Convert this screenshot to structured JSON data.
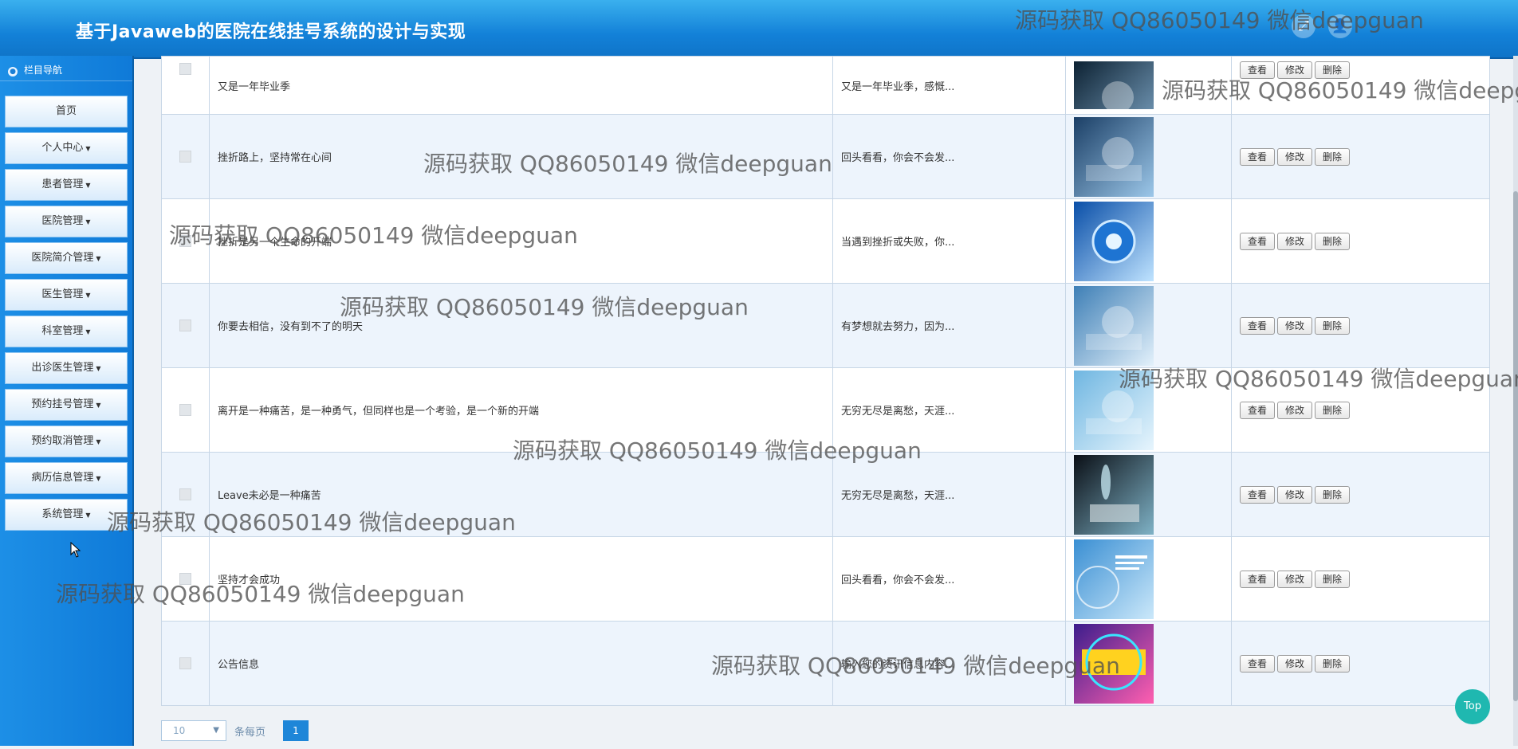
{
  "header": {
    "title": "基于Javaweb的医院在线挂号系统的设计与实现"
  },
  "sidebar": {
    "heading": "栏目导航",
    "items": [
      {
        "label": "首页",
        "dropdown": false
      },
      {
        "label": "个人中心",
        "dropdown": true
      },
      {
        "label": "患者管理",
        "dropdown": true
      },
      {
        "label": "医院管理",
        "dropdown": true
      },
      {
        "label": "医院简介管理",
        "dropdown": true
      },
      {
        "label": "医生管理",
        "dropdown": true
      },
      {
        "label": "科室管理",
        "dropdown": true
      },
      {
        "label": "出诊医生管理",
        "dropdown": true
      },
      {
        "label": "预约挂号管理",
        "dropdown": true
      },
      {
        "label": "预约取消管理",
        "dropdown": true
      },
      {
        "label": "病历信息管理",
        "dropdown": true
      },
      {
        "label": "系统管理",
        "dropdown": true
      }
    ]
  },
  "table": {
    "buttons": {
      "view": "查看",
      "edit": "修改",
      "delete": "删除"
    },
    "rows": [
      {
        "title": "又是一年毕业季",
        "summary": "又是一年毕业季，感慨...",
        "image": "medical-equipment"
      },
      {
        "title": "挫折路上，坚持常在心间",
        "summary": "回头看看，你会不会发...",
        "image": "operating-room"
      },
      {
        "title": "挫折是另一个生命的开端",
        "summary": "当遇到挫折或失败，你...",
        "image": "tech-capsule"
      },
      {
        "title": "你要去相信，没有到不了的明天",
        "summary": "有梦想就去努力，因为...",
        "image": "surgical-robot"
      },
      {
        "title": "离开是一种痛苦，是一种勇气，但同样也是一个考验，是一个新的开端",
        "summary": "无穷无尽是离愁，天涯...",
        "image": "lab-glassware"
      },
      {
        "title": "Leave未必是一种痛苦",
        "summary": "无穷无尽是离愁，天涯...",
        "image": "hologram-body"
      },
      {
        "title": "坚持才会成功",
        "summary": "回头看看，你会不会发...",
        "image": "business-presentation"
      },
      {
        "title": "公告信息",
        "summary": "输入您的资讯信息内容...",
        "image": "hot-news"
      }
    ]
  },
  "pager": {
    "page_size": "10",
    "per_page_label": "条每页",
    "current_page": "1"
  },
  "top_button": "Top",
  "watermark": "源码获取 QQ86050149 微信deepguan"
}
